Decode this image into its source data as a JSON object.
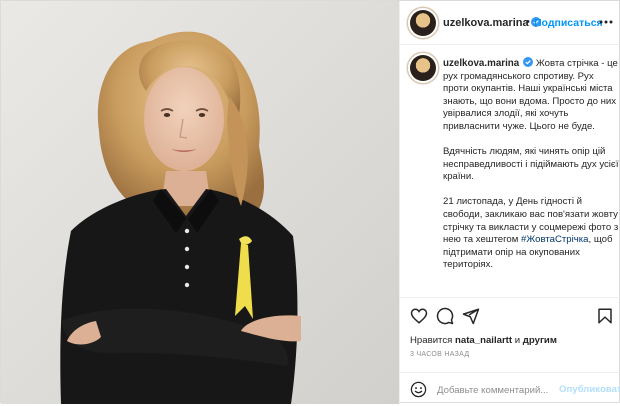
{
  "post": {
    "username": "uzelkova.marina",
    "follow_label": "Подписаться",
    "header_separator": "•",
    "caption": {
      "paragraph_1": "Жовта стрічка - це рух громадянського спротиву. Рух проти окупантів. Наші українські міста знають, що вони вдома. Просто до них увірвалися злодії, які хочуть привласнити чуже. Цього не буде.",
      "paragraph_2": "Вдячність людям, які чинять опір цій несправедливості і підіймають дух усієї країни.",
      "paragraph_3_before": "21 листопада, у День гідності й свободи, закликаю вас пов'язати жовту стрічку та викласти у соцмережі фото з нею та хештегом",
      "hashtag": "#ЖовтаСтрічка",
      "paragraph_3_after": ", щоб підтримати опір на окупованих територіях."
    },
    "likes": {
      "prefix": "Нравится",
      "user": "nata_nailartt",
      "suffix": "и",
      "others": "другим"
    },
    "timestamp": "3 часов назад",
    "comment": {
      "placeholder": "Добавьте комментарий...",
      "publish_label": "Опубликовать"
    }
  },
  "icons": {
    "verified": "verified-badge-icon",
    "more": "more-options-icon",
    "like": "heart-icon",
    "comment": "comment-bubble-icon",
    "share": "paper-plane-icon",
    "save": "bookmark-icon",
    "emoji": "smiley-icon"
  },
  "colors": {
    "accent": "#0095f6",
    "verified": "#3897f0",
    "publish_disabled": "#b2dffc",
    "ribbon": "#f2e15a",
    "hashtag": "#00376b"
  }
}
